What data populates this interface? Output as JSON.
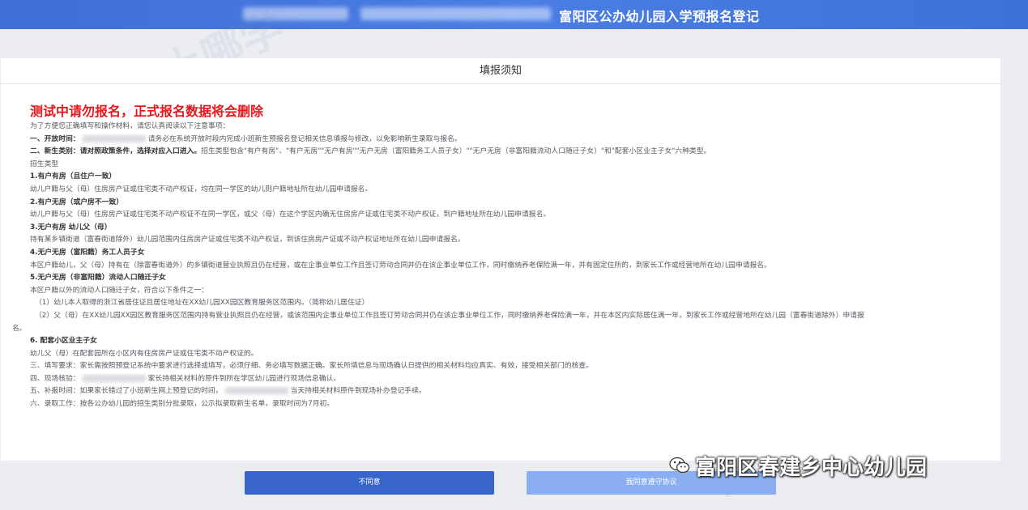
{
  "app": {
    "title": "富阳区公办幼儿园入学预报名登记"
  },
  "panel": {
    "header": "填报须知",
    "notice": "测试中请勿报名，正式报名数据将会删除"
  },
  "lines": {
    "intro": "为了方便您正确填写和操作材料，请您认真阅读以下注意事项：",
    "l1_label": "一、开放时间：",
    "l1_rest": "请务必在系统开放时段内完成小班新生预报名登记相关信息填报与修改，以免影响新生录取与报名。",
    "l2_label": "二、新生类别：请对照政策条件，选择对应入口进入。",
    "l2_rest": "招生类型包含\"有户有房\"、\"有户无房\"\"无户有房\"\"无户无房（富阳籍务工人员子女）\"\"无户无房（非富阳籍流动人口随迁子女）\"和\"配套小区业主子女\"六种类型。",
    "types": "招生类型",
    "t1": "1.有户有房（且住户一致）",
    "t1d": "幼儿户籍与父（母）住房房产证或住宅类不动产权证，均在同一学区的幼儿则户籍地址所在幼儿园申请报名。",
    "t2": "2.有户无房（或户房不一致）",
    "t2d": "幼儿户籍与父（母）住房房产证或住宅类不动产权证不在同一学区，或父（母）在这个学区内确无住房房产证或住宅类不动产权证，到户籍地址所在幼儿园申请报名。",
    "t3": "3.无户有房 幼儿父（母）",
    "t3d": "持有某乡镇街道（富春街道除外）幼儿园范围内住房房产证或住宅类不动产权证，到该住房房产证或不动产权证地址所在幼儿园申请报名。",
    "t4": "4.无户无房（富阳籍）务工人员子女",
    "t4d": "本区户籍幼儿，父（母）持有在（除富春街道外）的乡镇街道营业执照且仍在经营，或在企事业单位工作且签订劳动合同并仍在该企事业单位工作，同时缴纳养老保险满一年，并有固定住所的，到家长工作或经营地所在幼儿园申请报名。",
    "t5": "5.无户无房（非富阳籍）流动人口随迁子女",
    "t5d": "本区户籍以外的流动人口随迁子女，符合以下条件之一：",
    "t5c1": "（1）幼儿本人取得的浙江省居住证且居住地址在XX幼儿园XX园区教育服务区范围内。（简称幼儿居住证）",
    "t5c2a": "（2）父（母）在XX幼儿园XX园区教育服务区范围内持有营业执照且仍在经营，或该范围内企事业单位工作且签订劳动合同并仍在该企事业单位工作，同时缴纳养老保险满一年，并在本区内实际居住满一年，到家长工作或经营地所在幼儿园（富春街道除外）申请报",
    "t5c2b": "名。",
    "t6": "6. 配套小区业主子女",
    "t6d": "幼儿父（母）在配套园所在小区内有住房房产证或住宅类不动产权证的。",
    "l3": "三、填写要求：家长需按照预登记系统中要求进行选择或填写，必须仔细、务必填写数据正确。家长所填信息与现场确认日提供的相关材料均应真实、有效，接受相关部门的核查。",
    "l4a": "四、现场核验：",
    "l4b": "家长持相关材料的原件到所在学区幼儿园进行现场信息确认。",
    "l5a": "五、补报时间：如果家长错过了小班新生网上预登记的时间，",
    "l5b": "当天持相关材料原件到现场补办登记手续。",
    "l6": "六、录取工作：按各公办幼儿园的招生类别分批录取，公示拟录取新生名单，录取时间为7月初。"
  },
  "buttons": {
    "disagree": "不同意",
    "agree": "我同意遵守协议"
  },
  "brand": {
    "text": "富阳区春建乡中心幼儿园",
    "icon": "wechat-icon"
  },
  "watermark": {
    "text": "上哪学"
  },
  "colors": {
    "header": "#4576de",
    "notice": "#e8161c",
    "disagree_button": "#3765c9",
    "agree_button": "#8aaef0"
  }
}
